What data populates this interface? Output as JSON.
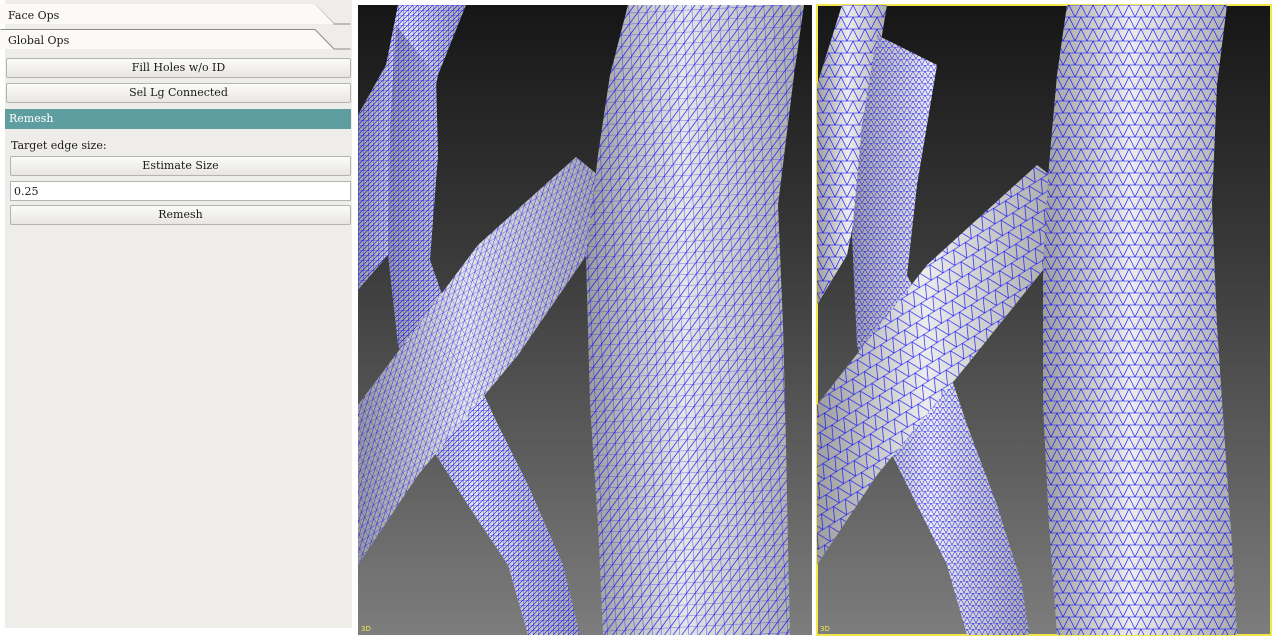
{
  "panel": {
    "sections": [
      {
        "label": "Face Ops"
      },
      {
        "label": "Global Ops"
      }
    ],
    "buttons": {
      "fill_holes": "Fill Holes w/o ID",
      "sel_lg_connected": "Sel Lg Connected"
    },
    "remesh": {
      "header": "Remesh",
      "target_label": "Target edge size:",
      "estimate_button": "Estimate Size",
      "edge_size_value": "0.25",
      "remesh_button": "Remesh"
    }
  },
  "viewports": {
    "left": {
      "label": "3D",
      "mesh_density": "fine"
    },
    "right": {
      "label": "3D",
      "mesh_density": "remeshed",
      "active": true
    }
  },
  "colors": {
    "accent": "#5f9ea0",
    "wireframe": "#0000ff",
    "surface": "#d9d9d9",
    "active_border": "#f2e64a",
    "panel_bg": "#efede9"
  }
}
